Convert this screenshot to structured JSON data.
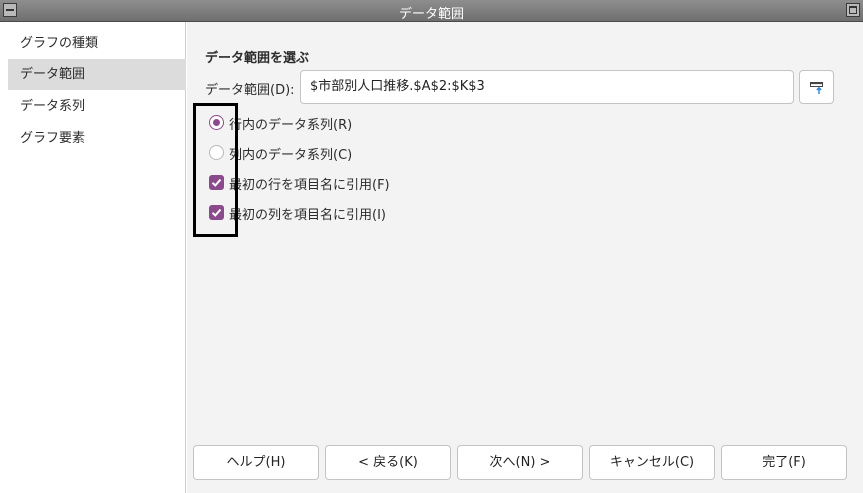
{
  "window": {
    "title": "データ範囲"
  },
  "sidebar": {
    "items": [
      {
        "label": "グラフの種類"
      },
      {
        "label": "データ範囲"
      },
      {
        "label": "データ系列"
      },
      {
        "label": "グラフ要素"
      }
    ],
    "selected": "データ範囲"
  },
  "main": {
    "section_title": "データ範囲を選ぶ",
    "range_label": "データ範囲(D):",
    "range_value": "$市部別人口推移.$A$2:$K$3",
    "options": {
      "rows": {
        "label": "行内のデータ系列(R)",
        "checked": true
      },
      "cols": {
        "label": "列内のデータ系列(C)",
        "checked": false
      },
      "first_row": {
        "label": "最初の行を項目名に引用(F)",
        "checked": true
      },
      "first_col": {
        "label": "最初の列を項目名に引用(I)",
        "checked": true
      }
    }
  },
  "buttons": {
    "help": "ヘルプ(H)",
    "back": "< 戻る(K)",
    "next": "次へ(N) >",
    "cancel": "キャンセル(C)",
    "finish": "完了(F)"
  },
  "colors": {
    "accent": "#8b4a8b",
    "selection": "#dcdcdc",
    "annotation": "#000000"
  }
}
